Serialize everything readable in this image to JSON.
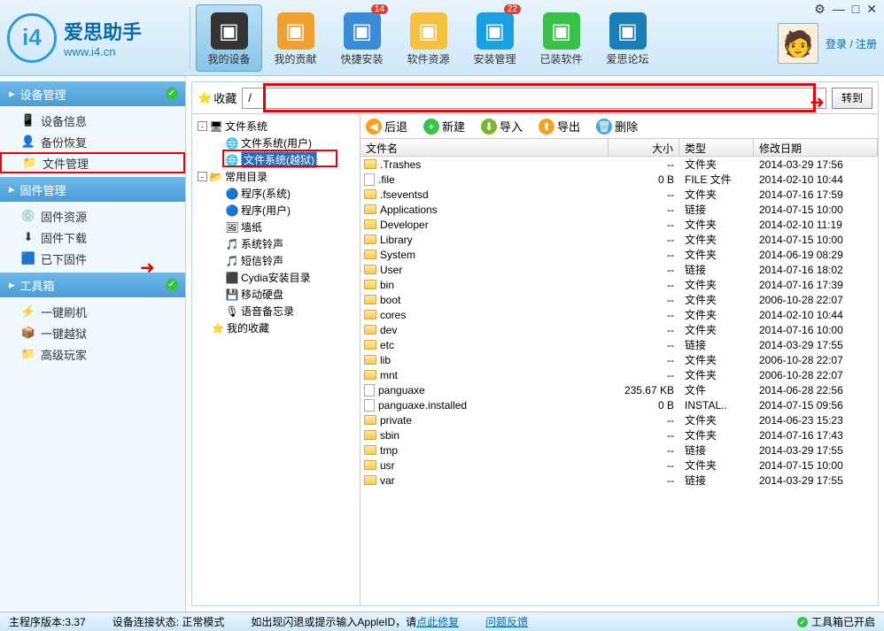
{
  "app": {
    "name": "爱思助手",
    "url": "www.i4.cn",
    "logo_text": "i4"
  },
  "toolbar": [
    {
      "label": "我的设备",
      "color": "#333",
      "badge": ""
    },
    {
      "label": "我的贡献",
      "color": "#f0a030",
      "badge": ""
    },
    {
      "label": "快捷安装",
      "color": "#3a8bd8",
      "badge": "14"
    },
    {
      "label": "软件资源",
      "color": "#f5c040",
      "badge": ""
    },
    {
      "label": "安装管理",
      "color": "#1aa0e0",
      "badge": "22"
    },
    {
      "label": "已装软件",
      "color": "#3ac14a",
      "badge": ""
    },
    {
      "label": "爱思论坛",
      "color": "#1a7db5",
      "badge": ""
    }
  ],
  "user": {
    "login_text": "登录 / 注册"
  },
  "win": {
    "settings": "⚙",
    "min": "—",
    "max": "□",
    "close": "✕"
  },
  "sidebar": {
    "sections": [
      {
        "title": "设备管理",
        "check": true,
        "items": [
          {
            "label": "设备信息",
            "icon": "📱",
            "hl": false
          },
          {
            "label": "备份恢复",
            "icon": "👤",
            "hl": false
          },
          {
            "label": "文件管理",
            "icon": "📁",
            "hl": true
          }
        ]
      },
      {
        "title": "固件管理",
        "check": false,
        "items": [
          {
            "label": "固件资源",
            "icon": "💿",
            "hl": false
          },
          {
            "label": "固件下载",
            "icon": "⬇",
            "hl": false
          },
          {
            "label": "已下固件",
            "icon": "🟦",
            "hl": false
          }
        ]
      },
      {
        "title": "工具箱",
        "check": true,
        "items": [
          {
            "label": "一键刷机",
            "icon": "⚡",
            "hl": false
          },
          {
            "label": "一键越狱",
            "icon": "📦",
            "hl": false
          },
          {
            "label": "高级玩家",
            "icon": "📁",
            "hl": false
          }
        ]
      }
    ]
  },
  "path": {
    "fav_label": "收藏",
    "value": "/",
    "goto": "转到"
  },
  "tree": [
    {
      "label": "文件系统",
      "indent": 0,
      "toggle": "-",
      "icon": "🖥",
      "sel": false
    },
    {
      "label": "文件系统(用户)",
      "indent": 1,
      "toggle": "",
      "icon": "🌐",
      "sel": false
    },
    {
      "label": "文件系统(越狱)",
      "indent": 1,
      "toggle": "",
      "icon": "🌐",
      "sel": true
    },
    {
      "label": "常用目录",
      "indent": 0,
      "toggle": "-",
      "icon": "📂",
      "sel": false
    },
    {
      "label": "程序(系统)",
      "indent": 1,
      "toggle": "",
      "icon": "🔵",
      "sel": false
    },
    {
      "label": "程序(用户)",
      "indent": 1,
      "toggle": "",
      "icon": "🔵",
      "sel": false
    },
    {
      "label": "墙纸",
      "indent": 1,
      "toggle": "",
      "icon": "🖼",
      "sel": false
    },
    {
      "label": "系统铃声",
      "indent": 1,
      "toggle": "",
      "icon": "🎵",
      "sel": false
    },
    {
      "label": "短信铃声",
      "indent": 1,
      "toggle": "",
      "icon": "🎵",
      "sel": false
    },
    {
      "label": "Cydia安装目录",
      "indent": 1,
      "toggle": "",
      "icon": "⬛",
      "sel": false
    },
    {
      "label": "移动硬盘",
      "indent": 1,
      "toggle": "",
      "icon": "💾",
      "sel": false
    },
    {
      "label": "语音备忘录",
      "indent": 1,
      "toggle": "",
      "icon": "🎙",
      "sel": false
    },
    {
      "label": "我的收藏",
      "indent": 0,
      "toggle": "",
      "icon": "⭐",
      "sel": false
    }
  ],
  "file_toolbar": {
    "back": "后退",
    "new": "新建",
    "import": "导入",
    "export": "导出",
    "delete": "删除"
  },
  "columns": {
    "name": "文件名",
    "size": "大小",
    "type": "类型",
    "date": "修改日期"
  },
  "files": [
    {
      "name": ".Trashes",
      "size": "--",
      "type": "文件夹",
      "date": "2014-03-29 17:56",
      "icon": "folder"
    },
    {
      "name": ".file",
      "size": "0 B",
      "type": "FILE 文件",
      "date": "2014-02-10 10:44",
      "icon": "file"
    },
    {
      "name": ".fseventsd",
      "size": "--",
      "type": "文件夹",
      "date": "2014-07-16 17:59",
      "icon": "folder"
    },
    {
      "name": "Applications",
      "size": "--",
      "type": "链接",
      "date": "2014-07-15 10:00",
      "icon": "folder"
    },
    {
      "name": "Developer",
      "size": "--",
      "type": "文件夹",
      "date": "2014-02-10 11:19",
      "icon": "folder"
    },
    {
      "name": "Library",
      "size": "--",
      "type": "文件夹",
      "date": "2014-07-15 10:00",
      "icon": "folder"
    },
    {
      "name": "System",
      "size": "--",
      "type": "文件夹",
      "date": "2014-06-19 08:29",
      "icon": "folder"
    },
    {
      "name": "User",
      "size": "--",
      "type": "链接",
      "date": "2014-07-16 18:02",
      "icon": "folder"
    },
    {
      "name": "bin",
      "size": "--",
      "type": "文件夹",
      "date": "2014-07-16 17:39",
      "icon": "folder"
    },
    {
      "name": "boot",
      "size": "--",
      "type": "文件夹",
      "date": "2006-10-28 22:07",
      "icon": "folder"
    },
    {
      "name": "cores",
      "size": "--",
      "type": "文件夹",
      "date": "2014-02-10 10:44",
      "icon": "folder"
    },
    {
      "name": "dev",
      "size": "--",
      "type": "文件夹",
      "date": "2014-07-16 10:00",
      "icon": "folder"
    },
    {
      "name": "etc",
      "size": "--",
      "type": "链接",
      "date": "2014-03-29 17:55",
      "icon": "folder"
    },
    {
      "name": "lib",
      "size": "--",
      "type": "文件夹",
      "date": "2006-10-28 22:07",
      "icon": "folder"
    },
    {
      "name": "mnt",
      "size": "--",
      "type": "文件夹",
      "date": "2006-10-28 22:07",
      "icon": "folder"
    },
    {
      "name": "panguaxe",
      "size": "235.67 KB",
      "type": "文件",
      "date": "2014-06-28 22:56",
      "icon": "file"
    },
    {
      "name": "panguaxe.installed",
      "size": "0 B",
      "type": "INSTAL..",
      "date": "2014-07-15 09:56",
      "icon": "file"
    },
    {
      "name": "private",
      "size": "--",
      "type": "文件夹",
      "date": "2014-06-23 15:23",
      "icon": "folder"
    },
    {
      "name": "sbin",
      "size": "--",
      "type": "文件夹",
      "date": "2014-07-16 17:43",
      "icon": "folder"
    },
    {
      "name": "tmp",
      "size": "--",
      "type": "链接",
      "date": "2014-03-29 17:55",
      "icon": "folder"
    },
    {
      "name": "usr",
      "size": "--",
      "type": "文件夹",
      "date": "2014-07-15 10:00",
      "icon": "folder"
    },
    {
      "name": "var",
      "size": "--",
      "type": "链接",
      "date": "2014-03-29 17:55",
      "icon": "folder"
    }
  ],
  "status": {
    "version_label": "主程序版本",
    "version": "3.37",
    "conn_label": "设备连接状态",
    "conn": "正常模式",
    "tip_pre": "如出现闪退或提示输入AppleID，请",
    "tip_link": "点此修复",
    "feedback": "问题反馈",
    "toolbox": "工具箱已开启"
  }
}
